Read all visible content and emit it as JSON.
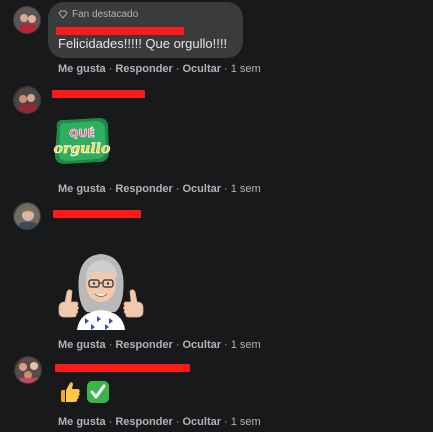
{
  "comments": [
    {
      "badge": "Fan destacado",
      "text": "Felicidades!!!!! Que orgullo!!!!",
      "actions": {
        "like": "Me gusta",
        "reply": "Responder",
        "hide": "Ocultar",
        "time": "1 sem"
      }
    },
    {
      "sticker": {
        "line1": "QUÉ",
        "line2": "orgullo"
      },
      "actions": {
        "like": "Me gusta",
        "reply": "Responder",
        "hide": "Ocultar",
        "time": "1 sem"
      }
    },
    {
      "sticker": "avatar-thumbs-up-sticker",
      "actions": {
        "like": "Me gusta",
        "reply": "Responder",
        "hide": "Ocultar",
        "time": "1 sem"
      }
    },
    {
      "emojis": [
        "👍",
        "✅"
      ],
      "actions": {
        "like": "Me gusta",
        "reply": "Responder",
        "hide": "Ocultar",
        "time": "1 sem"
      }
    }
  ],
  "separator": "·",
  "colors": {
    "background": "#18191a",
    "bubble": "#3a3b3c",
    "redaction": "#ff1a1a",
    "meta_text": "#b0b3b8"
  }
}
